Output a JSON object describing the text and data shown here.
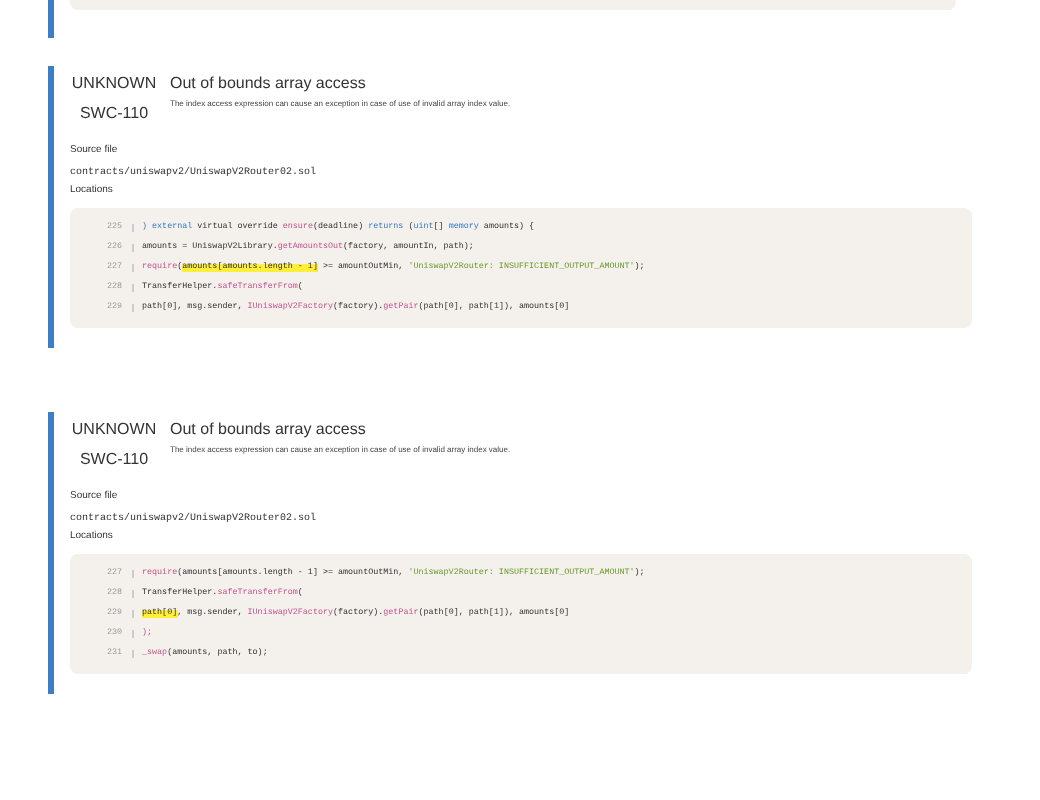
{
  "issues": [
    {
      "severity": "UNKNOWN",
      "swc": "SWC-110",
      "title": "Out of bounds array access",
      "description": "The index access expression can cause an exception in case of use of invalid array index value.",
      "source_label": "Source file",
      "source_file": "contracts/uniswapv2/UniswapV2Router02.sol",
      "locations_label": "Locations",
      "lines": [
        {
          "number": "225",
          "segments": [
            {
              "kind": "keyword",
              "text": ") external"
            },
            {
              "kind": "plain",
              "text": " virtual override "
            },
            {
              "kind": "func",
              "text": "ensure"
            },
            {
              "kind": "plain",
              "text": "(deadline) "
            },
            {
              "kind": "keyword",
              "text": "returns"
            },
            {
              "kind": "plain",
              "text": " ("
            },
            {
              "kind": "keyword",
              "text": "uint"
            },
            {
              "kind": "plain",
              "text": "[] "
            },
            {
              "kind": "keyword",
              "text": "memory"
            },
            {
              "kind": "plain",
              "text": " amounts) {"
            }
          ]
        },
        {
          "number": "226",
          "segments": [
            {
              "kind": "plain",
              "text": "amounts = UniswapV2Library."
            },
            {
              "kind": "func",
              "text": "getAmountsOut"
            },
            {
              "kind": "plain",
              "text": "(factory, amountIn, path);"
            }
          ]
        },
        {
          "number": "227",
          "segments": [
            {
              "kind": "func",
              "text": "require"
            },
            {
              "kind": "plain",
              "text": "("
            },
            {
              "kind": "highlight",
              "text": "amounts[amounts.length - 1]"
            },
            {
              "kind": "plain",
              "text": " >= amountOutMin, "
            },
            {
              "kind": "string",
              "text": "'UniswapV2Router: INSUFFICIENT_OUTPUT_AMOUNT'"
            },
            {
              "kind": "plain",
              "text": ");"
            }
          ]
        },
        {
          "number": "228",
          "segments": [
            {
              "kind": "plain",
              "text": "TransferHelper."
            },
            {
              "kind": "func",
              "text": "safeTransferFrom"
            },
            {
              "kind": "plain",
              "text": "("
            }
          ]
        },
        {
          "number": "229",
          "segments": [
            {
              "kind": "plain",
              "text": "path[0], msg.sender, "
            },
            {
              "kind": "func",
              "text": "IUniswapV2Factory"
            },
            {
              "kind": "plain",
              "text": "(factory)."
            },
            {
              "kind": "func",
              "text": "getPair"
            },
            {
              "kind": "plain",
              "text": "(path[0], path[1]), amounts[0]"
            }
          ]
        }
      ]
    },
    {
      "severity": "UNKNOWN",
      "swc": "SWC-110",
      "title": "Out of bounds array access",
      "description": "The index access expression can cause an exception in case of use of invalid array index value.",
      "source_label": "Source file",
      "source_file": "contracts/uniswapv2/UniswapV2Router02.sol",
      "locations_label": "Locations",
      "lines": [
        {
          "number": "227",
          "segments": [
            {
              "kind": "func",
              "text": "require"
            },
            {
              "kind": "plain",
              "text": "(amounts[amounts.length - 1] >= amountOutMin, "
            },
            {
              "kind": "string",
              "text": "'UniswapV2Router: INSUFFICIENT_OUTPUT_AMOUNT'"
            },
            {
              "kind": "plain",
              "text": ");"
            }
          ]
        },
        {
          "number": "228",
          "segments": [
            {
              "kind": "plain",
              "text": "TransferHelper."
            },
            {
              "kind": "func",
              "text": "safeTransferFrom"
            },
            {
              "kind": "plain",
              "text": "("
            }
          ]
        },
        {
          "number": "229",
          "segments": [
            {
              "kind": "highlight",
              "text": "path[0]"
            },
            {
              "kind": "plain",
              "text": ", msg.sender, "
            },
            {
              "kind": "func",
              "text": "IUniswapV2Factory"
            },
            {
              "kind": "plain",
              "text": "(factory)."
            },
            {
              "kind": "func",
              "text": "getPair"
            },
            {
              "kind": "plain",
              "text": "(path[0], path[1]), amounts[0]"
            }
          ]
        },
        {
          "number": "230",
          "segments": [
            {
              "kind": "func",
              "text": ");"
            }
          ]
        },
        {
          "number": "231",
          "segments": [
            {
              "kind": "func",
              "text": "_swap"
            },
            {
              "kind": "plain",
              "text": "(amounts, path, to);"
            }
          ]
        }
      ]
    }
  ]
}
